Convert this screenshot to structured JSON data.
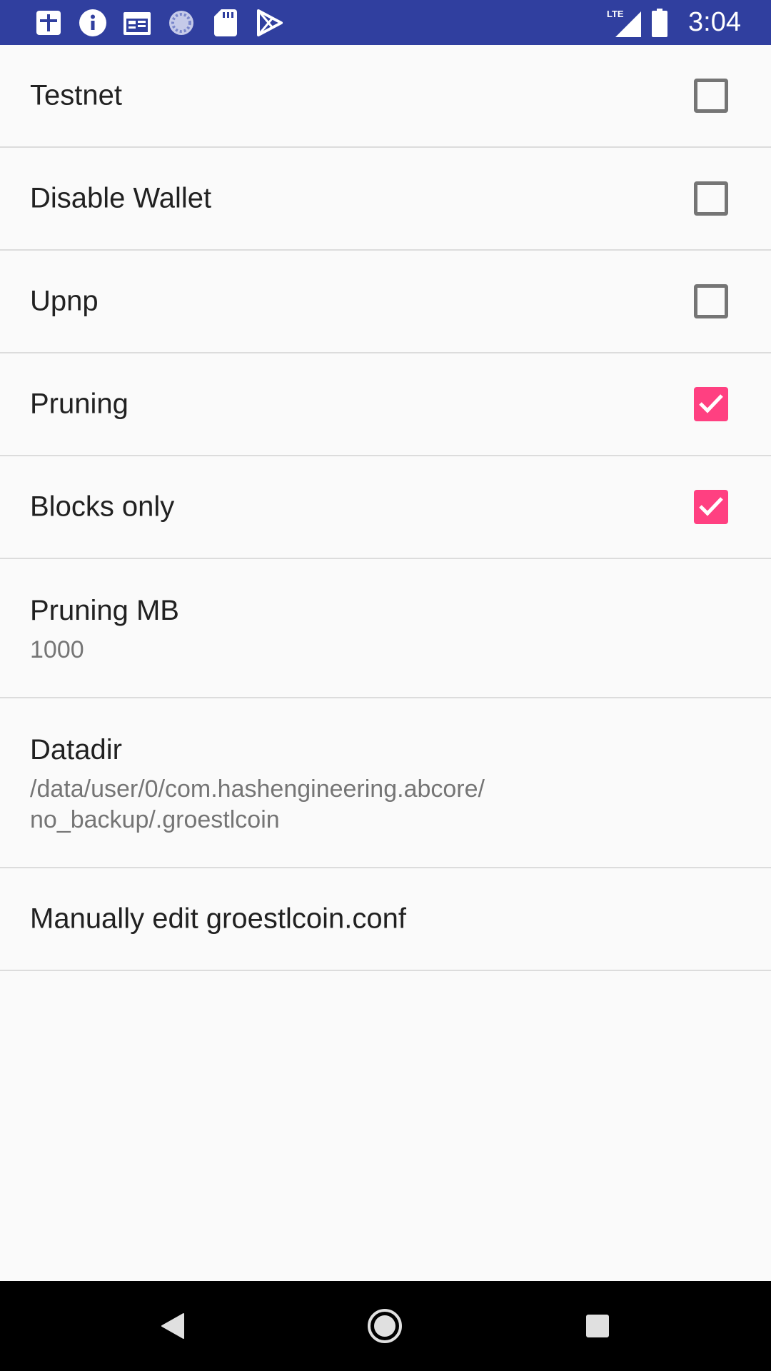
{
  "status_bar": {
    "time": "3:04",
    "network": "LTE",
    "icons": [
      "app-plus-icon",
      "info-icon",
      "calendar-icon",
      "progress-circle-icon",
      "sd-card-icon",
      "play-store-icon"
    ],
    "background": "#303f9f"
  },
  "settings": {
    "testnet": {
      "title": "Testnet",
      "checked": false
    },
    "disable_wallet": {
      "title": "Disable Wallet",
      "checked": false
    },
    "upnp": {
      "title": "Upnp",
      "checked": false
    },
    "pruning": {
      "title": "Pruning",
      "checked": true
    },
    "blocks_only": {
      "title": "Blocks only",
      "checked": true
    },
    "pruning_mb": {
      "title": "Pruning MB",
      "summary": "1000"
    },
    "datadir": {
      "title": "Datadir",
      "summary_line1": "/data/user/0/com.hashengineering.abcore/",
      "summary_line2": "no_backup/.groestlcoin"
    },
    "manual_edit": {
      "title": "Manually edit groestlcoin.conf"
    }
  },
  "colors": {
    "accent": "#ff4081",
    "checkbox_border": "#757575",
    "divider": "#dcdcdc"
  },
  "nav_bar": {
    "buttons": [
      "back-icon",
      "home-icon",
      "recents-icon"
    ]
  }
}
